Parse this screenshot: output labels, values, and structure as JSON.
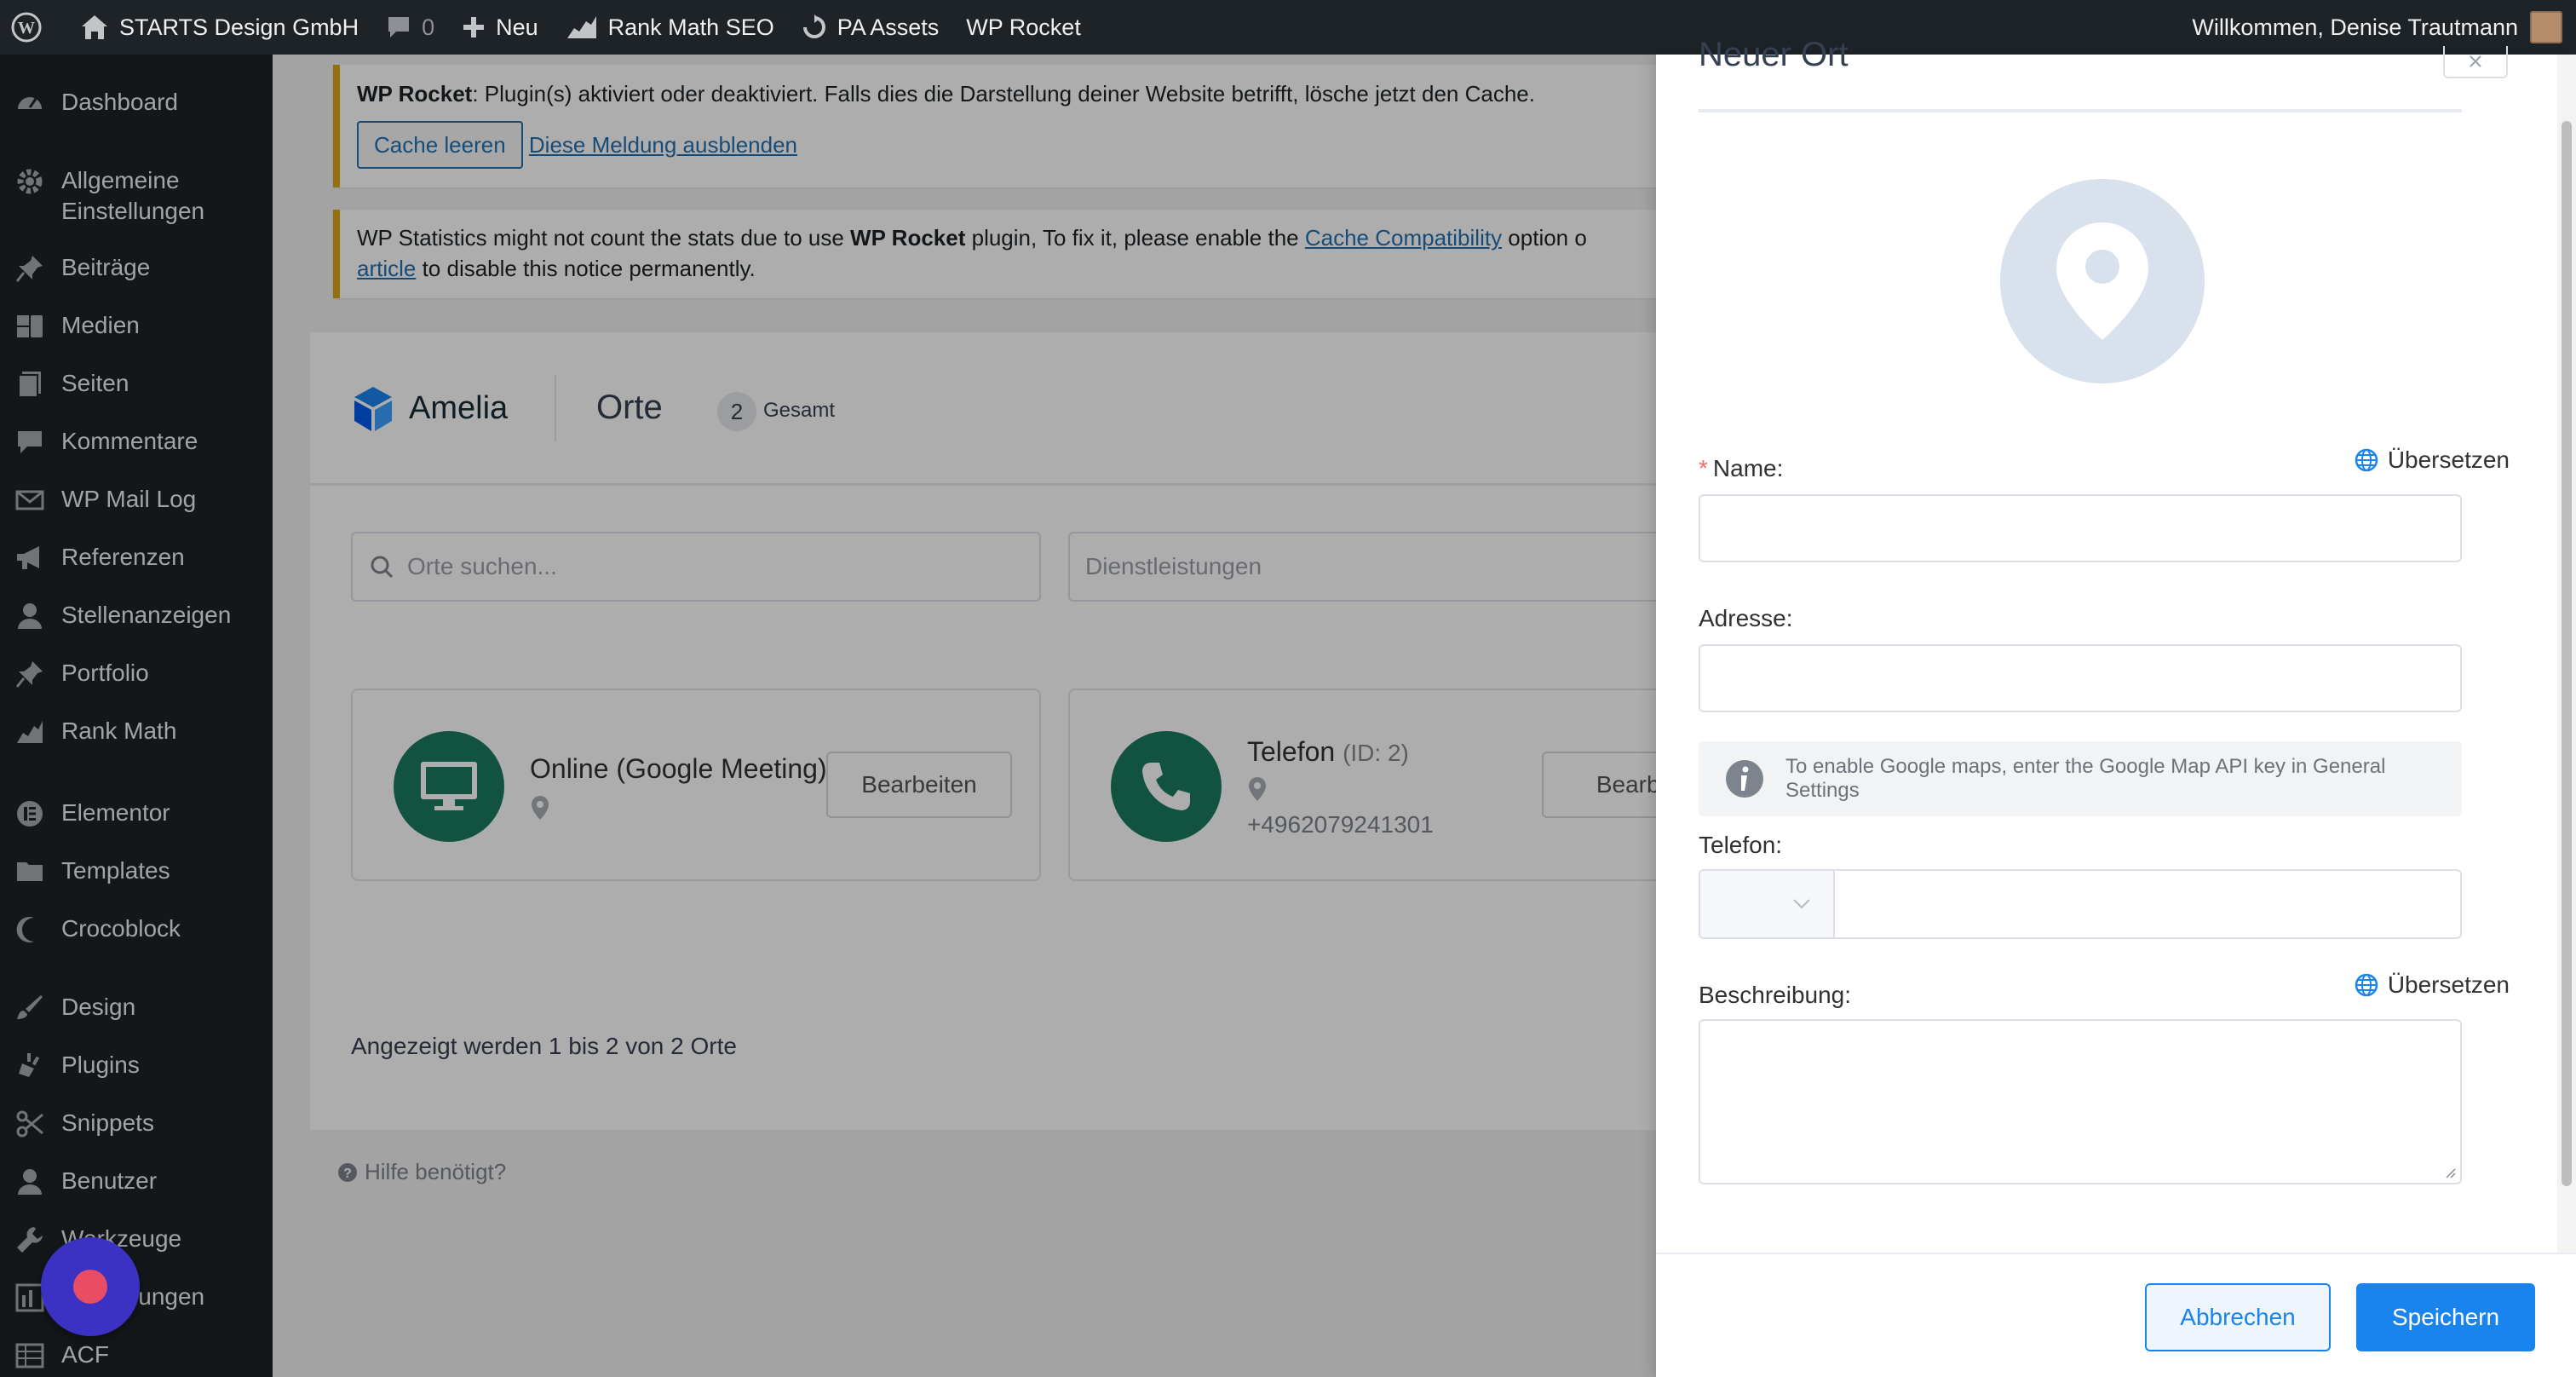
{
  "adminbar": {
    "site_name": "STARTS Design GmbH",
    "comments_count": "0",
    "new_label": "Neu",
    "rank_math": "Rank Math SEO",
    "pa_assets": "PA Assets",
    "wp_rocket": "WP Rocket",
    "greeting": "Willkommen, Denise Trautmann"
  },
  "sidebar": {
    "items": [
      {
        "label": "Dashboard",
        "icon": "dashboard-icon"
      },
      {
        "label": "Allgemeine Einstellungen",
        "icon": "gear-icon"
      },
      {
        "label": "Beiträge",
        "icon": "pin-icon"
      },
      {
        "label": "Medien",
        "icon": "media-icon"
      },
      {
        "label": "Seiten",
        "icon": "pages-icon"
      },
      {
        "label": "Kommentare",
        "icon": "comment-icon"
      },
      {
        "label": "WP Mail Log",
        "icon": "mail-icon"
      },
      {
        "label": "Referenzen",
        "icon": "megaphone-icon"
      },
      {
        "label": "Stellenanzeigen",
        "icon": "user-icon"
      },
      {
        "label": "Portfolio",
        "icon": "pin-icon"
      },
      {
        "label": "Rank Math",
        "icon": "rank-math-icon"
      },
      {
        "label": "Elementor",
        "icon": "elementor-icon"
      },
      {
        "label": "Templates",
        "icon": "folder-icon"
      },
      {
        "label": "Crocoblock",
        "icon": "crocoblock-icon"
      },
      {
        "label": "Design",
        "icon": "brush-icon"
      },
      {
        "label": "Plugins",
        "icon": "plugin-icon"
      },
      {
        "label": "Snippets",
        "icon": "scissors-icon"
      },
      {
        "label": "Benutzer",
        "icon": "user-icon"
      },
      {
        "label": "Werkzeuge",
        "icon": "wrench-icon"
      },
      {
        "label": "Einstellungen",
        "icon": "settings-icon"
      },
      {
        "label": "ACF",
        "icon": "table-icon"
      }
    ]
  },
  "notices": {
    "rocket_bold": "WP Rocket",
    "rocket_text": ": Plugin(s) aktiviert oder deaktiviert. Falls dies die Darstellung deiner Website betrifft, lösche jetzt den Cache.",
    "cache_button": "Cache leeren",
    "dismiss_link": "Diese Meldung ausblenden",
    "stats_text_1": "WP Statistics might not count the stats due to use ",
    "stats_bold": "WP Rocket",
    "stats_text_2": " plugin, To fix it, please enable the ",
    "stats_link": "Cache Compatibility",
    "stats_text_3": " option o",
    "stats_article": "article",
    "stats_text_4": " to disable this notice permanently."
  },
  "amelia": {
    "brand": "Amelia",
    "page_title": "Orte",
    "count": "2",
    "count_label": "Gesamt",
    "search_placeholder": "Orte suchen...",
    "services_placeholder": "Dienstleistungen",
    "locations": [
      {
        "name": "Online (Google Meeting)",
        "id": "",
        "phone": "",
        "edit_label": "Bearbeiten",
        "icon": "monitor-icon"
      },
      {
        "name": "Telefon",
        "id": "(ID: 2)",
        "phone": "+4962079241301",
        "edit_label": "Bearbe",
        "icon": "phone-icon"
      }
    ],
    "pagination": "Angezeigt werden 1 bis 2 von 2 Orte",
    "help": "Hilfe benötigt?"
  },
  "drawer": {
    "title": "Neuer Ort",
    "name_label": "Name:",
    "translate_label": "Übersetzen",
    "address_label": "Adresse:",
    "maps_info": "To enable Google maps, enter the Google Map API key in General Settings",
    "phone_label": "Telefon:",
    "description_label": "Beschreibung:",
    "cancel_button": "Abbrechen",
    "save_button": "Speichern"
  },
  "colors": {
    "wp_dark": "#1d2327",
    "accent": "#1a84ee",
    "amelia_green": "#1a7b5f",
    "notice_yellow": "#dba617"
  }
}
